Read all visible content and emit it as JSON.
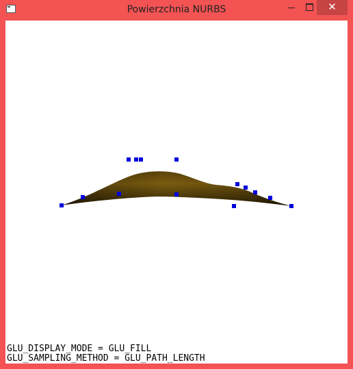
{
  "window": {
    "title": "Powierzchnia NURBS",
    "controls": {
      "minimize_icon": "minimize-icon",
      "maximize_icon": "maximize-icon",
      "close_icon": "close-icon",
      "close_glyph": "✕"
    },
    "colors": {
      "titlebar": "#f35353",
      "close_hover": "#c74444"
    }
  },
  "scene": {
    "surface_colors": {
      "light": "#8a6a14",
      "dark": "#2a1f05"
    },
    "control_point_color": "#0000dd"
  },
  "status": {
    "lines": [
      "GLU_DISPLAY_MODE = GLU_FILL",
      "GLU_SAMPLING_METHOD = GLU_PATH_LENGTH"
    ]
  }
}
